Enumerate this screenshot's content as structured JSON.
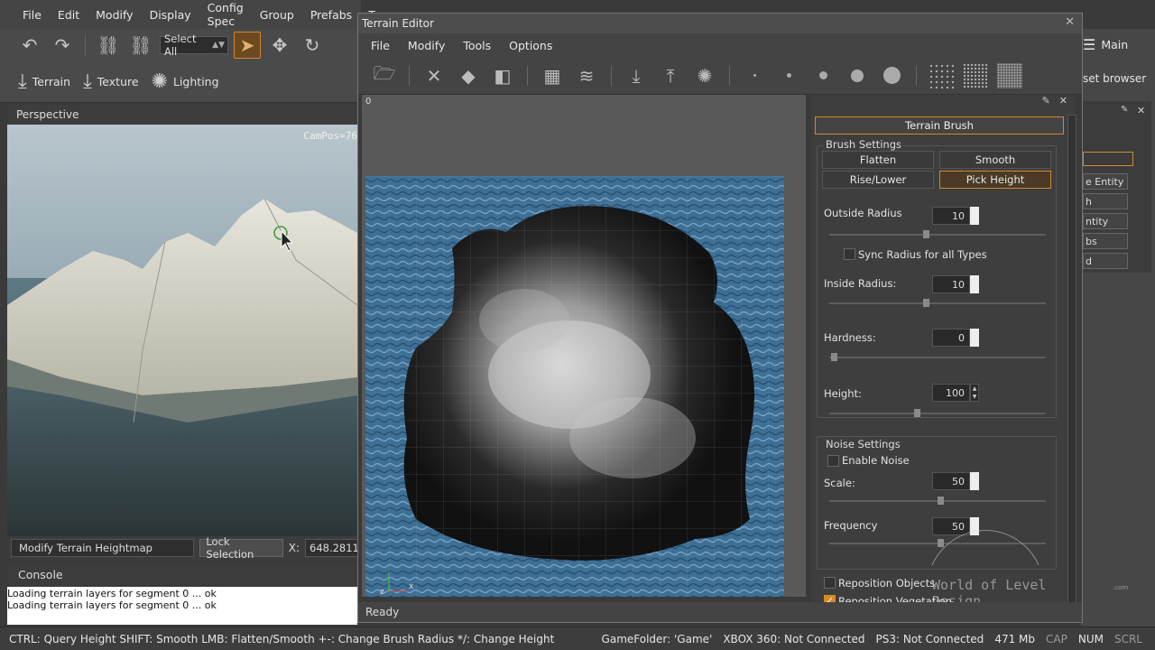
{
  "main_menu": [
    "File",
    "Edit",
    "Modify",
    "Display",
    "Config Spec",
    "Group",
    "Prefabs",
    "Te"
  ],
  "toolbar": {
    "select_all": "Select All"
  },
  "toolbar2": {
    "terrain": "Terrain",
    "texture": "Texture",
    "lighting": "Lighting"
  },
  "viewport": {
    "title": "Perspective",
    "campos": "CamPos=76"
  },
  "viewport_footer": {
    "mode": "Modify Terrain Heightmap",
    "lock": "Lock Selection",
    "x_label": "X:",
    "x_value": "648.2811"
  },
  "console": {
    "title": "Console",
    "lines": [
      "Loading terrain layers for segment 0 ... ok",
      "Loading terrain layers for segment 0 ... ok"
    ]
  },
  "status_bar": {
    "hint": "CTRL: Query Height  SHIFT: Smooth  LMB: Flatten/Smooth  +-: Change Brush Radius  */: Change Height",
    "game_folder": "GameFolder: 'Game'",
    "xbox": "XBOX 360: Not Connected",
    "ps3": "PS3: Not Connected",
    "memory": "471 Mb",
    "cap": "CAP",
    "num": "NUM",
    "scrl": "SCRL"
  },
  "right_side": {
    "main": "Main",
    "asset_browser": "set browser",
    "list": [
      "e Entity",
      "h",
      "ntity",
      "bs",
      "d"
    ]
  },
  "terrain_editor": {
    "title": "Terrain Editor",
    "menu": [
      "File",
      "Modify",
      "Tools",
      "Options"
    ],
    "map_origin": "0",
    "status": "Ready",
    "axis_x": "x",
    "axis_z": "z",
    "brush": {
      "header": "Terrain Brush",
      "brush_settings": "Brush Settings",
      "modes": [
        "Flatten",
        "Smooth",
        "Rise/Lower",
        "Pick Height"
      ],
      "selected_mode": "Pick Height",
      "outside_radius_label": "Outside Radius",
      "outside_radius": "10",
      "sync_radius": "Sync Radius for all Types",
      "sync_radius_checked": false,
      "inside_radius_label": "Inside Radius:",
      "inside_radius": "10",
      "hardness_label": "Hardness:",
      "hardness": "0",
      "height_label": "Height:",
      "height": "100",
      "noise_settings": "Noise Settings",
      "enable_noise": "Enable Noise",
      "enable_noise_checked": false,
      "scale_label": "Scale:",
      "scale": "50",
      "frequency_label": "Frequency",
      "frequency": "50",
      "reposition_objects": "Reposition Objects",
      "reposition_objects_checked": false,
      "reposition_vegetation": "Reposition Vegetation",
      "reposition_vegetation_checked": true,
      "watermark": "World of Level Design",
      "watermark_suffix": ".com"
    }
  },
  "colors": {
    "accent": "#d08a2e",
    "background": "#3a3a3a",
    "water": "#3e6f95"
  }
}
